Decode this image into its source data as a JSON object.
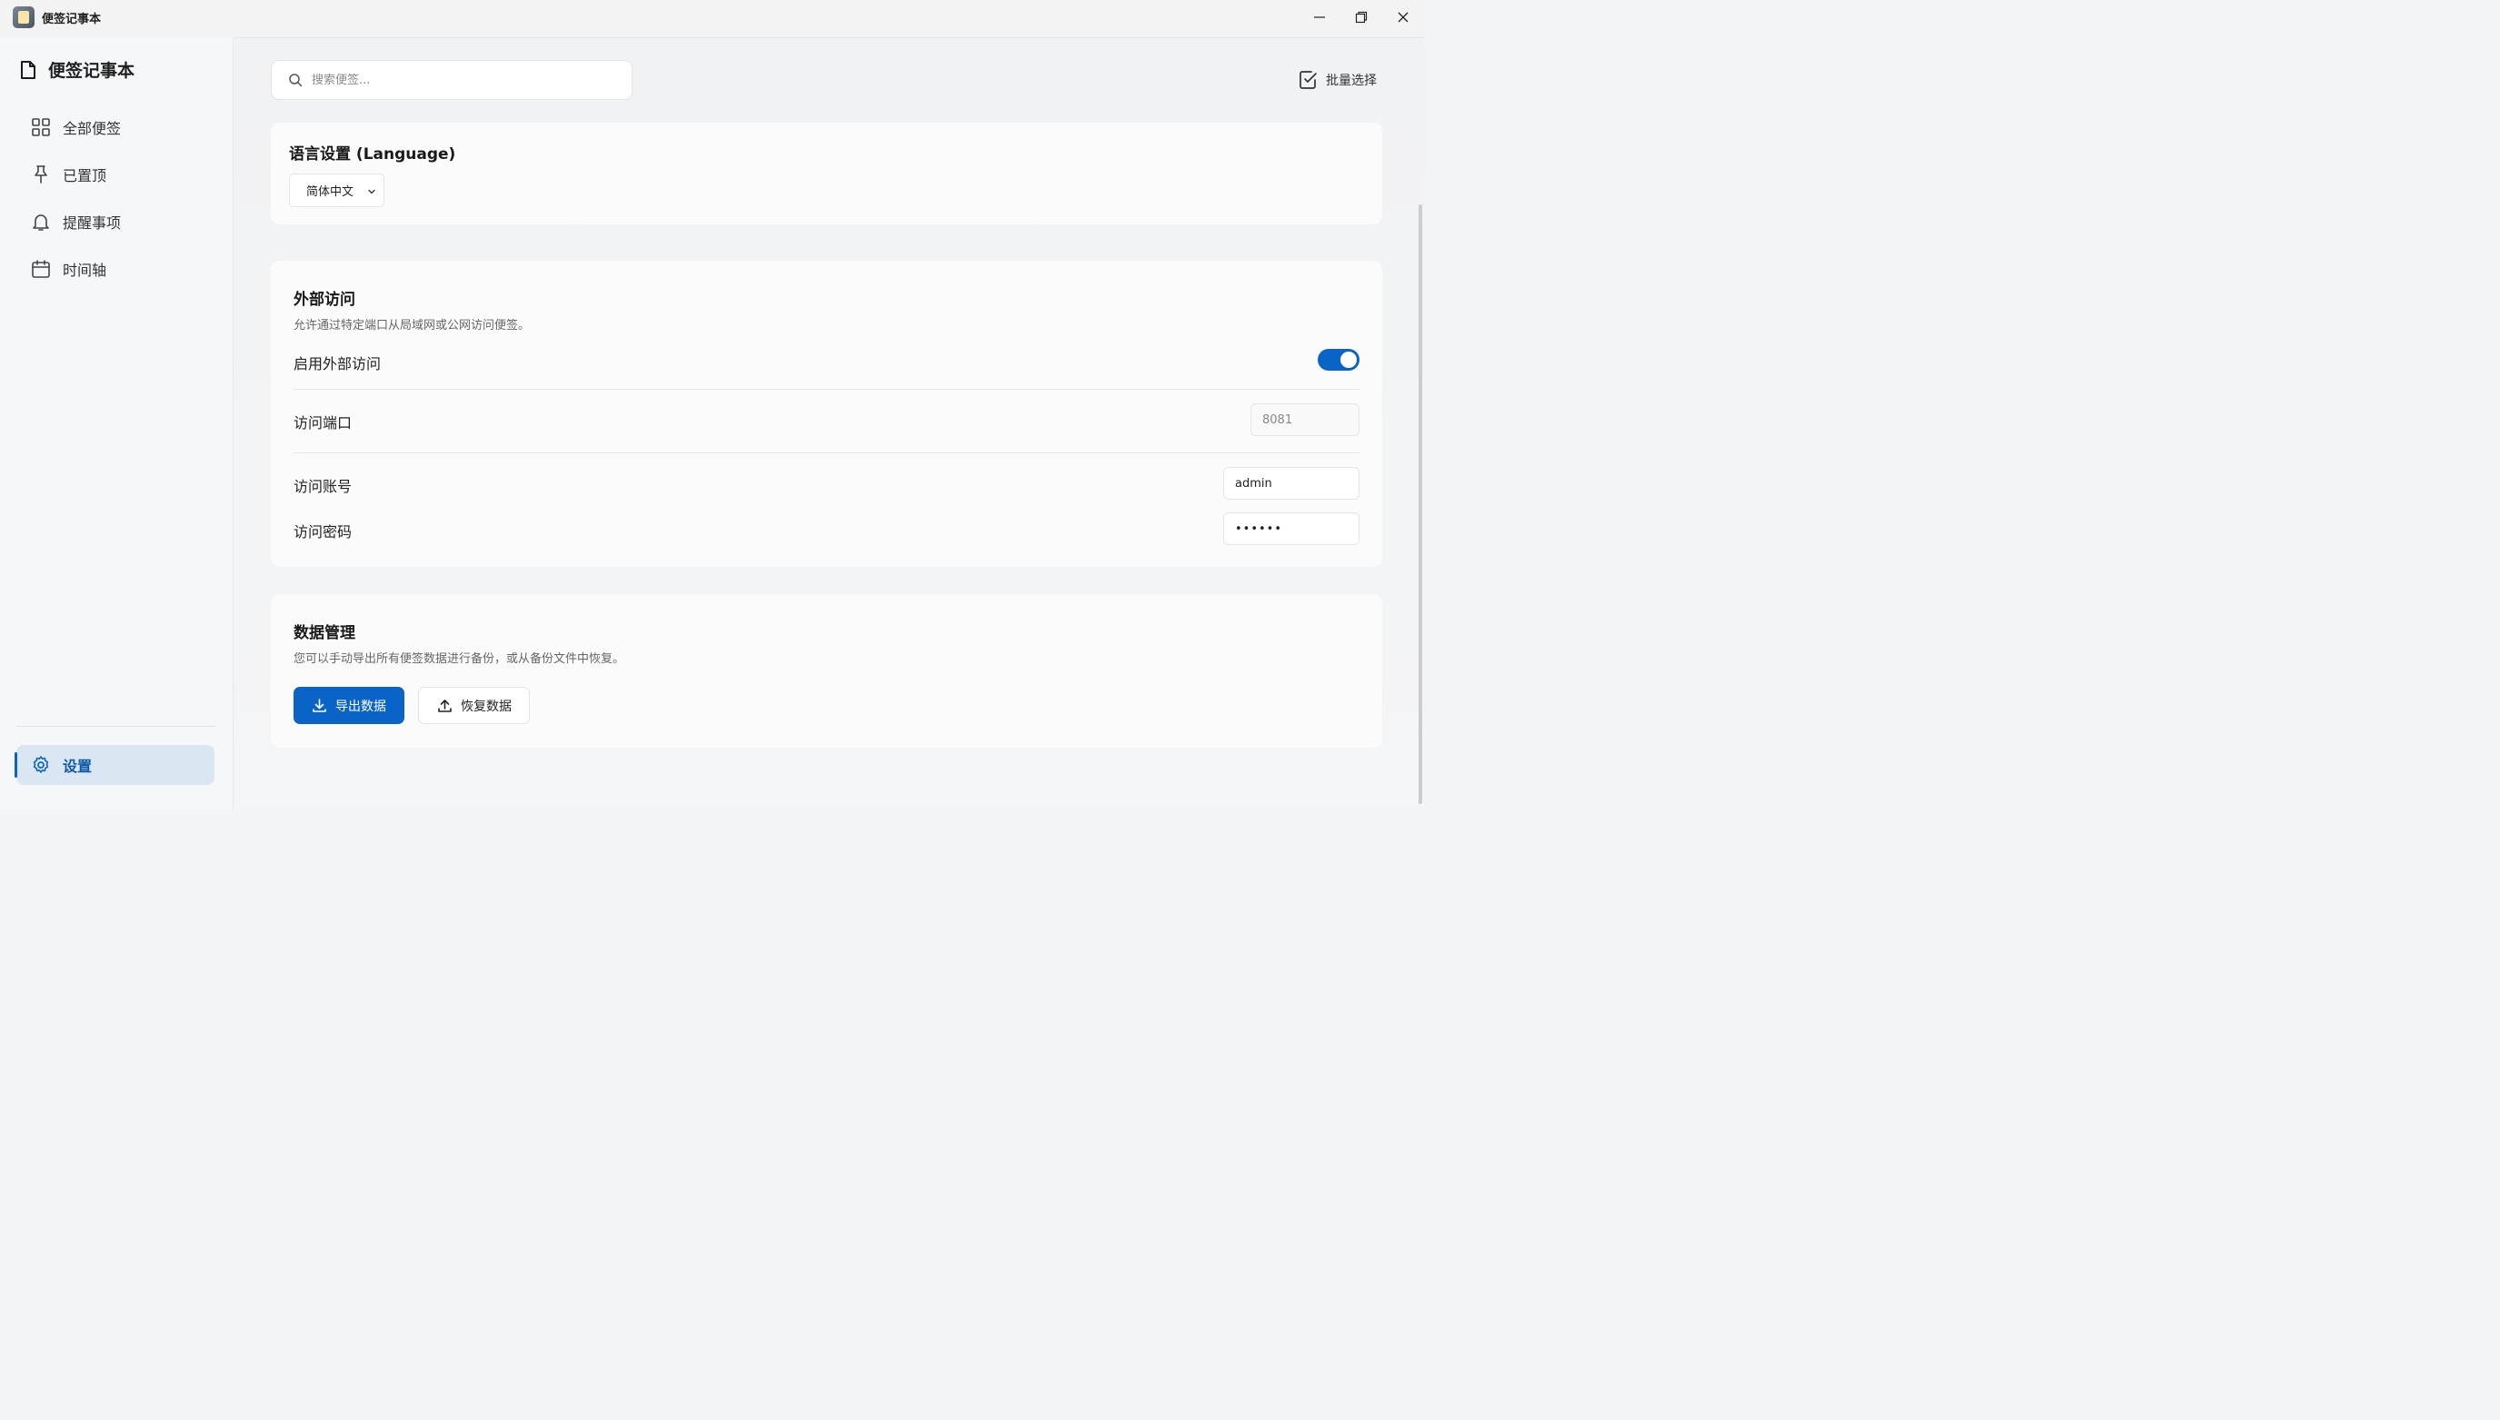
{
  "window": {
    "title": "便签记事本"
  },
  "sidebar": {
    "brand": "便签记事本",
    "items": [
      {
        "label": "全部便签",
        "icon": "grid-icon"
      },
      {
        "label": "已置顶",
        "icon": "pin-icon"
      },
      {
        "label": "提醒事项",
        "icon": "bell-icon"
      },
      {
        "label": "时间轴",
        "icon": "calendar-icon"
      }
    ],
    "settings_label": "设置"
  },
  "toolbar": {
    "search_placeholder": "搜索便签...",
    "batch_select_label": "批量选择"
  },
  "language": {
    "title": "语言设置 (Language)",
    "selected": "简体中文"
  },
  "external_access": {
    "title": "外部访问",
    "description": "允许通过特定端口从局域网或公网访问便签。",
    "enable_label": "启用外部访问",
    "enabled": true,
    "port_label": "访问端口",
    "port_value": "8081",
    "account_label": "访问账号",
    "account_value": "admin",
    "password_label": "访问密码",
    "password_value": "••••••"
  },
  "data_management": {
    "title": "数据管理",
    "description": "您可以手动导出所有便签数据进行备份，或从备份文件中恢复。",
    "export_label": "导出数据",
    "restore_label": "恢复数据"
  },
  "colors": {
    "accent": "#0a64c8",
    "active_bg": "#dbe6f3"
  }
}
